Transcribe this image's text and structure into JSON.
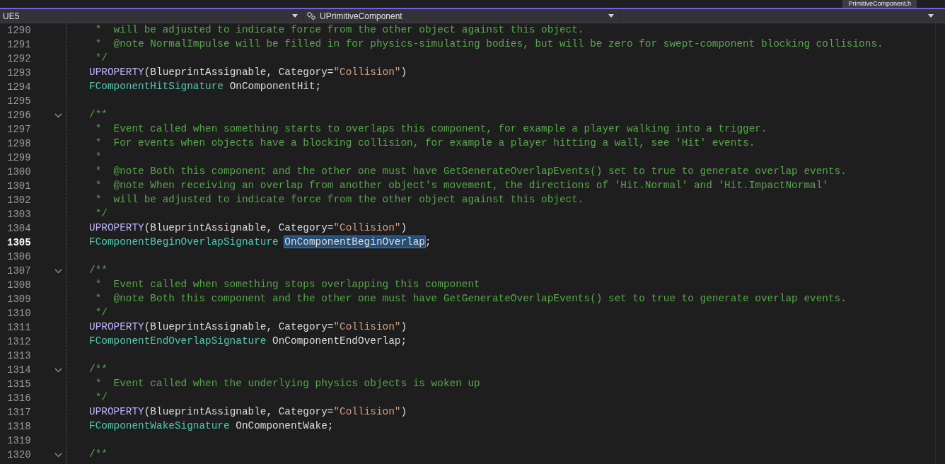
{
  "document_tab": {
    "title": "PrimitiveComponent.h"
  },
  "nav_bar": {
    "project": "UE5",
    "scope": "UPrimitiveComponent"
  },
  "editor": {
    "lines": [
      {
        "number": "1290",
        "current": false,
        "kind": "code",
        "segments": [
          {
            "kind": "comment",
            "text": " *  will be adjusted to indicate force from the other object against this object."
          }
        ]
      },
      {
        "number": "1291",
        "current": false,
        "kind": "code",
        "segments": [
          {
            "kind": "comment",
            "text": " *  @note NormalImpulse will be filled in for physics-simulating bodies, but will be zero for swept-component blocking collisions."
          }
        ]
      },
      {
        "number": "1292",
        "current": false,
        "kind": "code",
        "segments": [
          {
            "kind": "comment",
            "text": " */"
          }
        ]
      },
      {
        "number": "1293",
        "current": false,
        "kind": "code",
        "segments": [
          {
            "kind": "macro",
            "text": "UPROPERTY"
          },
          {
            "kind": "plain",
            "text": "(BlueprintAssignable, Category="
          },
          {
            "kind": "string",
            "text": "\"Collision\""
          },
          {
            "kind": "plain",
            "text": ")"
          }
        ]
      },
      {
        "number": "1294",
        "current": false,
        "kind": "code",
        "segments": [
          {
            "kind": "type",
            "text": "FComponentHitSignature"
          },
          {
            "kind": "plain",
            "text": " OnComponentHit;"
          }
        ]
      },
      {
        "number": "1295",
        "current": false,
        "kind": "code"
      },
      {
        "number": "1296",
        "current": false,
        "kind": "fold_start",
        "segments": [
          {
            "kind": "comment",
            "text": "/**"
          }
        ]
      },
      {
        "number": "1297",
        "current": false,
        "kind": "code",
        "segments": [
          {
            "kind": "comment",
            "text": " *  Event called when something starts to overlaps this component, for example a player walking into a trigger."
          }
        ]
      },
      {
        "number": "1298",
        "current": false,
        "kind": "code",
        "segments": [
          {
            "kind": "comment",
            "text": " *  For events when objects have a blocking collision, for example a player hitting a wall, see 'Hit' events."
          }
        ]
      },
      {
        "number": "1299",
        "current": false,
        "kind": "code",
        "segments": [
          {
            "kind": "comment",
            "text": " *"
          }
        ]
      },
      {
        "number": "1300",
        "current": false,
        "kind": "code",
        "segments": [
          {
            "kind": "comment",
            "text": " *  @note Both this component and the other one must have GetGenerateOverlapEvents() set to true to generate overlap events."
          }
        ]
      },
      {
        "number": "1301",
        "current": false,
        "kind": "code",
        "segments": [
          {
            "kind": "comment",
            "text": " *  @note When receiving an overlap from another object's movement, the directions of 'Hit.Normal' and 'Hit.ImpactNormal'"
          }
        ]
      },
      {
        "number": "1302",
        "current": false,
        "kind": "code",
        "segments": [
          {
            "kind": "comment",
            "text": " *  will be adjusted to indicate force from the other object against this object."
          }
        ]
      },
      {
        "number": "1303",
        "current": false,
        "kind": "code",
        "segments": [
          {
            "kind": "comment",
            "text": " */"
          }
        ]
      },
      {
        "number": "1304",
        "current": false,
        "kind": "code",
        "segments": [
          {
            "kind": "macro",
            "text": "UPROPERTY"
          },
          {
            "kind": "plain",
            "text": "(BlueprintAssignable, Category="
          },
          {
            "kind": "string",
            "text": "\"Collision\""
          },
          {
            "kind": "plain",
            "text": ")"
          }
        ]
      },
      {
        "number": "1305",
        "current": true,
        "kind": "code",
        "segments": [
          {
            "kind": "type",
            "text": "FComponentBeginOverlapSignature "
          },
          {
            "kind": "selection",
            "text": "OnComponentBeginOverlap"
          },
          {
            "kind": "plain",
            "text": ";"
          }
        ]
      },
      {
        "number": "1306",
        "current": false,
        "kind": "code"
      },
      {
        "number": "1307",
        "current": false,
        "kind": "fold_start",
        "segments": [
          {
            "kind": "comment",
            "text": "/**"
          }
        ]
      },
      {
        "number": "1308",
        "current": false,
        "kind": "code",
        "segments": [
          {
            "kind": "comment",
            "text": " *  Event called when something stops overlapping this component"
          }
        ]
      },
      {
        "number": "1309",
        "current": false,
        "kind": "code",
        "segments": [
          {
            "kind": "comment",
            "text": " *  @note Both this component and the other one must have GetGenerateOverlapEvents() set to true to generate overlap events."
          }
        ]
      },
      {
        "number": "1310",
        "current": false,
        "kind": "code",
        "segments": [
          {
            "kind": "comment",
            "text": " */"
          }
        ]
      },
      {
        "number": "1311",
        "current": false,
        "kind": "code",
        "segments": [
          {
            "kind": "macro",
            "text": "UPROPERTY"
          },
          {
            "kind": "plain",
            "text": "(BlueprintAssignable, Category="
          },
          {
            "kind": "string",
            "text": "\"Collision\""
          },
          {
            "kind": "plain",
            "text": ")"
          }
        ]
      },
      {
        "number": "1312",
        "current": false,
        "kind": "code",
        "segments": [
          {
            "kind": "type",
            "text": "FComponentEndOverlapSignature"
          },
          {
            "kind": "plain",
            "text": " OnComponentEndOverlap;"
          }
        ]
      },
      {
        "number": "1313",
        "current": false,
        "kind": "code"
      },
      {
        "number": "1314",
        "current": false,
        "kind": "fold_start",
        "segments": [
          {
            "kind": "comment",
            "text": "/**"
          }
        ]
      },
      {
        "number": "1315",
        "current": false,
        "kind": "code",
        "segments": [
          {
            "kind": "comment",
            "text": " *  Event called when the underlying physics objects is woken up"
          }
        ]
      },
      {
        "number": "1316",
        "current": false,
        "kind": "code",
        "segments": [
          {
            "kind": "comment",
            "text": " */"
          }
        ]
      },
      {
        "number": "1317",
        "current": false,
        "kind": "code",
        "segments": [
          {
            "kind": "macro",
            "text": "UPROPERTY"
          },
          {
            "kind": "plain",
            "text": "(BlueprintAssignable, Category="
          },
          {
            "kind": "string",
            "text": "\"Collision\""
          },
          {
            "kind": "plain",
            "text": ")"
          }
        ]
      },
      {
        "number": "1318",
        "current": false,
        "kind": "code",
        "segments": [
          {
            "kind": "type",
            "text": "FComponentWakeSignature"
          },
          {
            "kind": "plain",
            "text": " OnComponentWake;"
          }
        ]
      },
      {
        "number": "1319",
        "current": false,
        "kind": "code"
      },
      {
        "number": "1320",
        "current": false,
        "kind": "fold_start",
        "segments": [
          {
            "kind": "comment",
            "text": "/**"
          }
        ]
      }
    ]
  }
}
